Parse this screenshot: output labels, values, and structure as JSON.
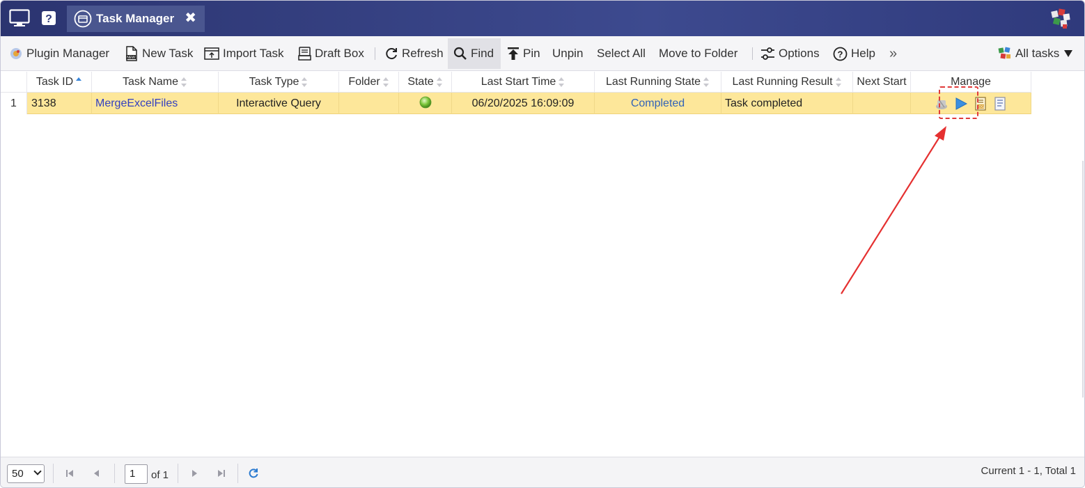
{
  "titlebar": {
    "tab_title": "Task Manager",
    "icons": [
      "monitor-icon",
      "help-icon",
      "task-manager-icon",
      "close-icon",
      "app-logo"
    ]
  },
  "toolbar": {
    "plugin_manager": "Plugin Manager",
    "new_task": "New Task",
    "import_task": "Import Task",
    "draft_box": "Draft Box",
    "refresh": "Refresh",
    "find": "Find",
    "pin": "Pin",
    "unpin": "Unpin",
    "select_all": "Select All",
    "move_to_folder": "Move to Folder",
    "options": "Options",
    "help": "Help",
    "more": "»",
    "filter": "All tasks"
  },
  "grid": {
    "columns": {
      "task_id": "Task ID",
      "task_name": "Task Name",
      "task_type": "Task Type",
      "folder": "Folder",
      "state": "State",
      "last_start_time": "Last Start Time",
      "last_running_state": "Last Running State",
      "last_running_result": "Last Running Result",
      "next_start": "Next Start",
      "manage": "Manage"
    },
    "rows": [
      {
        "num": "1",
        "task_id": "3138",
        "task_name": "MergeExcelFiles",
        "task_type": "Interactive Query",
        "folder": "",
        "state_color": "#7cc63a",
        "last_start_time": "06/20/2025 16:09:09",
        "last_running_state": "Completed",
        "last_running_result": "Task completed",
        "next_start": "",
        "manage_icons": [
          "stop-icon",
          "run-icon",
          "log-icon",
          "details-icon"
        ]
      }
    ]
  },
  "footer": {
    "page_size": "50",
    "page_current": "1",
    "page_of": "of 1",
    "summary": "Current 1 - 1, Total 1"
  },
  "colors": {
    "titlebar": "#2f3a7c",
    "row_selected": "#fde79a",
    "annotation": "#e03a3a",
    "link": "#3340c0"
  }
}
